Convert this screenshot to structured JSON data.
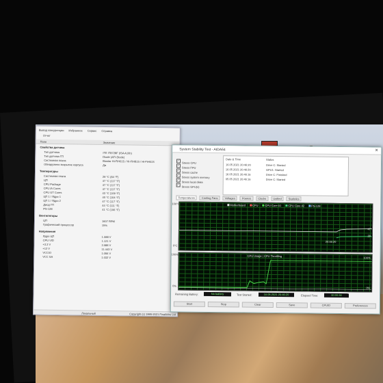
{
  "main_window": {
    "menu": [
      "Вывод конкуренции",
      "Избранное",
      "Сервис",
      "Справка"
    ],
    "toolbar": [
      "Отчет"
    ],
    "columns": [
      "Поле",
      "Значение"
    ],
    "sections": [
      {
        "title": "Свойства датчика",
        "rows": [
          {
            "label": "Тип датчика",
            "value": "ITE IT8728F (ISA A10h)"
          },
          {
            "label": "Тип датчика ГП",
            "value": "Diode (ATI-Diode)"
          },
          {
            "label": "Системная плата",
            "value": "Biostar Hi-FiH61S / Hi-FiH81S / Hi-FiH61S"
          },
          {
            "label": "Обнаружено вскрытие корпуса",
            "value": "Да"
          }
        ]
      },
      {
        "title": "Температуры",
        "rows": [
          {
            "label": "Системная плата",
            "value": "29 °C (84 °F)"
          },
          {
            "label": "ЦП",
            "value": "47 °C (117 °F)"
          },
          {
            "label": "CPU Package",
            "value": "47 °C (117 °F)"
          },
          {
            "label": "CPU IA Cores",
            "value": "47 °C (117 °F)"
          },
          {
            "label": "CPU GT Cores",
            "value": "43 °C (109 °F)"
          },
          {
            "label": "ЦП 1 / Ядро 1",
            "value": "40 °C (104 °F)"
          },
          {
            "label": "ЦП 1 / Ядро 2",
            "value": "47 °C (117 °F)"
          },
          {
            "label": "Диод ГП",
            "value": "44 °C (111 °F)"
          },
          {
            "label": "PS-128",
            "value": "41 °C (106 °F)"
          }
        ]
      },
      {
        "title": "Вентиляторы",
        "rows": [
          {
            "label": "ЦП",
            "value": "1607 RPM"
          },
          {
            "label": "Графический процессор",
            "value": "15%"
          }
        ]
      },
      {
        "title": "Напряжения",
        "rows": [
          {
            "label": "Ядро ЦП",
            "value": "1.088 V"
          },
          {
            "label": "CPU VID",
            "value": "1.121 V"
          },
          {
            "label": "+3.3 V",
            "value": "3.088 V"
          },
          {
            "label": "+12 V",
            "value": "11.443 V"
          },
          {
            "label": "VCCIO",
            "value": "1.056 V"
          },
          {
            "label": "VCC SA",
            "value": "1.032 V"
          }
        ]
      }
    ],
    "status_left": "Локальный",
    "status_right": "Copyright (c) 1995-2021 FinalWire Ltd."
  },
  "aida": {
    "title": "System Stability Test - AIDA64",
    "stress": [
      "Stress CPU",
      "Stress FPU",
      "Stress cache",
      "Stress system memory",
      "Stress local disks",
      "Stress GPU(s)"
    ],
    "log_headers": [
      "Date & Time",
      "Status"
    ],
    "log": [
      {
        "time": "16.05.2021 20:46:20",
        "status": "Drive C: Started"
      },
      {
        "time": "16.05.2021 20:46:20",
        "status": "GPU1: Started"
      },
      {
        "time": "16.05.2021 20:46:16",
        "status": "Drive C: Finished"
      },
      {
        "time": "05.05.2021 20:46:16",
        "status": "Drive C: Started"
      }
    ],
    "tabs": [
      "Temperatures",
      "Cooling Fans",
      "Voltages",
      "Powers",
      "Clocks",
      "Unified",
      "Statistics"
    ],
    "legend": [
      "Motherboard",
      "CPU",
      "CPU Core #1",
      "CPU Core #2",
      "PS-128"
    ],
    "top_ymax": "100°C",
    "top_ymin": "0°C",
    "top_time": "20:46:20",
    "top_readings": [
      "47",
      "29"
    ],
    "bottom_title": "CPU Usage | CPU Throttling",
    "bottom_ymax": "100%",
    "bottom_ymin": "0%",
    "bottom_right_max": "100%",
    "bottom_right_min": "0%",
    "battery_label": "Remaining Battery:",
    "battery_value": "No battery",
    "started_label": "Test Started:",
    "started_value": "16.05.2021 20:46:20",
    "elapsed_label": "Elapsed Time:",
    "elapsed_value": "00:00:36",
    "buttons": [
      "Start",
      "Stop",
      "Clear",
      "Save",
      "CPUID",
      "Preferences"
    ]
  },
  "colors": {
    "graph_bg": "#030f05",
    "grid": "#1f7a1f",
    "line": "#e6e6e6",
    "elapsed": "#76ff6b"
  }
}
